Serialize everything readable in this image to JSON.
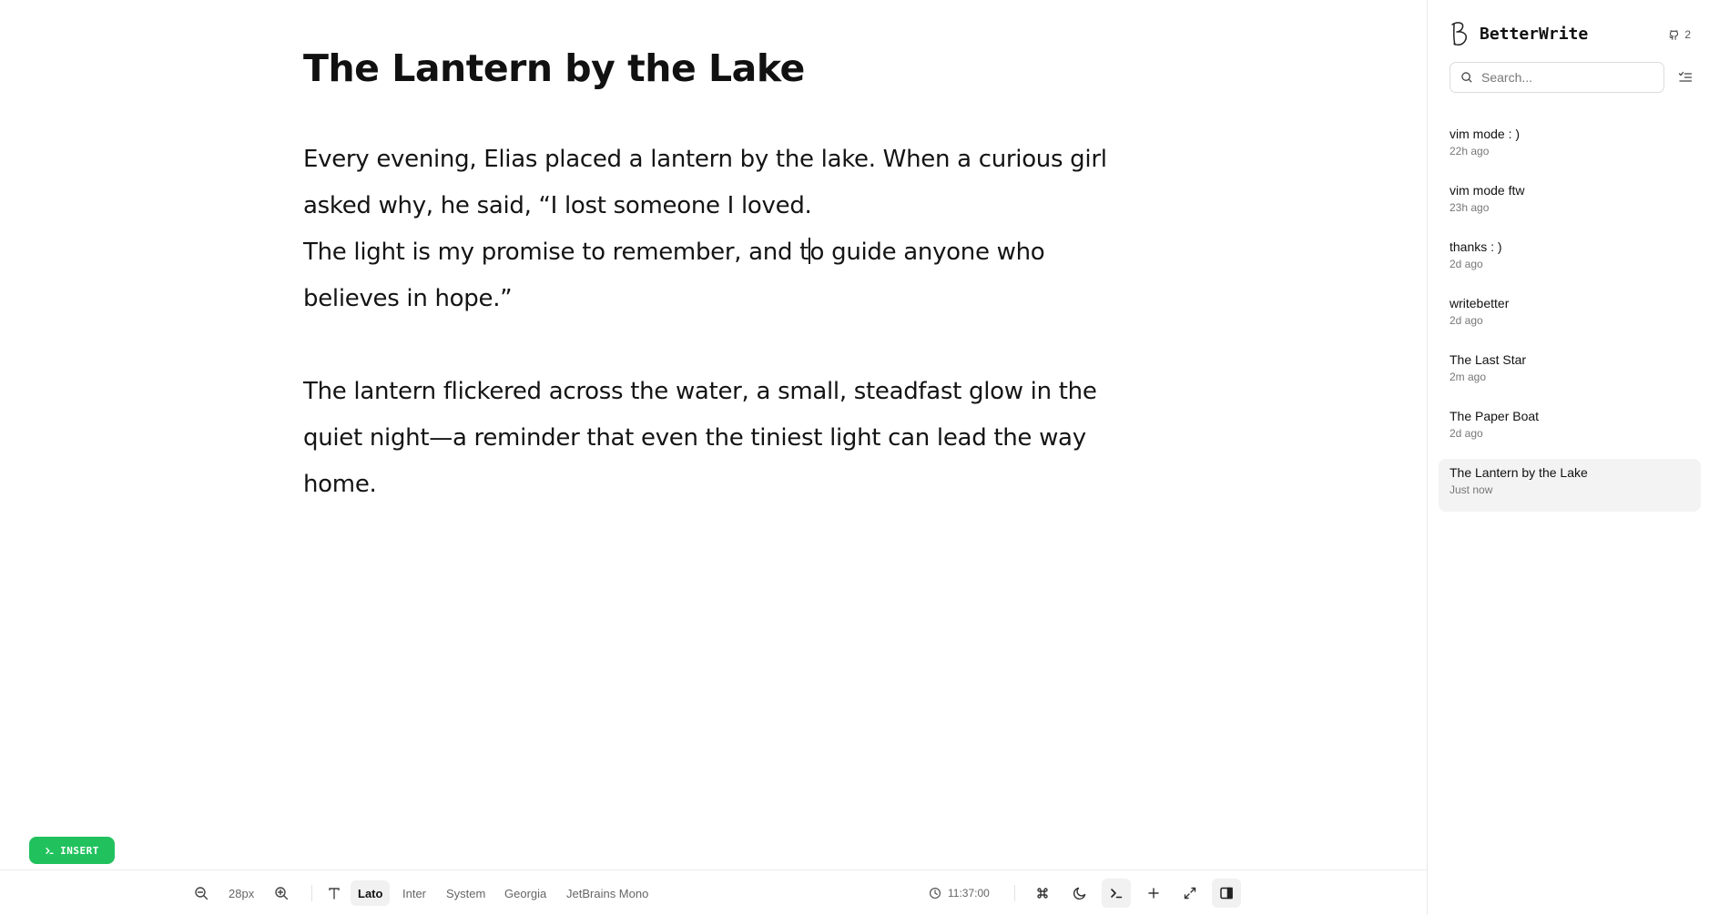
{
  "document": {
    "title": "The Lantern by the Lake",
    "paragraphs": [
      {
        "before_caret": "Every evening, Elias placed a lantern by the lake. When a curious girl asked why, he said, “I lost someone I loved.",
        "line2_before_caret": "The light is my promise to remember, and t",
        "line2_after_caret": "o guide anyone who believes in hope.”"
      },
      {
        "text": "The lantern flickered across the water, a small, steadfast glow in the quiet night—a reminder that even the tiniest light can lead the way home."
      }
    ]
  },
  "mode_badge": {
    "label": "INSERT",
    "icon": "terminal-icon",
    "color": "#21c25e"
  },
  "toolbar": {
    "zoom_out_icon": "zoom-out-icon",
    "font_size": "28px",
    "zoom_in_icon": "zoom-in-icon",
    "font_icon": "type-icon",
    "fonts": [
      "Lato",
      "Inter",
      "System",
      "Georgia",
      "JetBrains Mono"
    ],
    "active_font": "Lato",
    "timer": "11:37:00",
    "buttons": [
      "command-icon",
      "moon-icon",
      "terminal-icon",
      "plus-icon",
      "expand-icon",
      "sidebar-icon"
    ]
  },
  "sidebar": {
    "brand": "BetterWrite",
    "stars": "2",
    "search_placeholder": "Search...",
    "notes": [
      {
        "title": "vim mode : )",
        "time": "22h ago"
      },
      {
        "title": "vim mode ftw",
        "time": "23h ago"
      },
      {
        "title": "thanks : )",
        "time": "2d ago"
      },
      {
        "title": "writebetter",
        "time": "2d ago"
      },
      {
        "title": "The Last Star",
        "time": "2m ago"
      },
      {
        "title": "The Paper Boat",
        "time": "2d ago"
      },
      {
        "title": "The Lantern by the Lake",
        "time": "Just now"
      }
    ],
    "active_note_index": 6
  }
}
